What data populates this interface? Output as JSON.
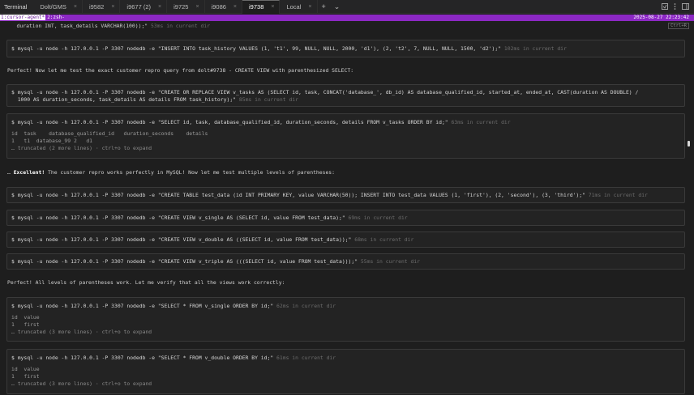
{
  "app_title": "Terminal",
  "tabs": [
    {
      "label": "Dolt/GMS"
    },
    {
      "label": "i9582"
    },
    {
      "label": "i9677 (2)"
    },
    {
      "label": "i9725"
    },
    {
      "label": "i9086"
    },
    {
      "label": "i9738"
    },
    {
      "label": "Local"
    }
  ],
  "tab_close_glyph": "×",
  "tab_add_glyph": "+",
  "tab_menu_glyph": "⌄",
  "status": {
    "session": "1:cursor-agent*",
    "window": "2:zsh-",
    "clock": "2025-08-27 22:23:42"
  },
  "ctrl_hint": "Ctrl+R",
  "top_line": "   duration INT, task_details VARCHAR(100));\"",
  "top_line_meta": " 53ms in current dir",
  "blocks": [
    {
      "cmd": "$ mysql -u node -h 127.0.0.1 -P 3307 nodedb -e \"INSERT INTO task_history VALUES (1, 't1', 99, NULL, NULL, 2000, 'd1'), (2, 't2', 7, NULL, NULL, 1500, 'd2');\"",
      "meta": " 102ms in current dir"
    },
    {
      "cmd": "$ mysql -u node -h 127.0.0.1 -P 3307 nodedb -e \"CREATE OR REPLACE VIEW v_tasks AS (SELECT id, task, CONCAT('database_', db_id) AS database_qualified_id, started_at, ended_at, CAST(duration AS DOUBLE) /",
      "cmd2": "  1000 AS duration_seconds, task_details AS details FROM task_history);\"",
      "meta": " 85ms in current dir"
    },
    {
      "cmd": "$ mysql -u node -h 127.0.0.1 -P 3307 nodedb -e \"SELECT id, task, database_qualified_id, duration_seconds, details FROM v_tasks ORDER BY id;\"",
      "meta": " 63ms in current dir",
      "out1": "id  task    database_qualified_id   duration_seconds    details",
      "out2": "1   t1  database_99 2   d1",
      "trunc": "… truncated (2 more lines) · ctrl+o to expand"
    },
    {
      "cmd": "$ mysql -u node -h 127.0.0.1 -P 3307 nodedb -e \"CREATE TABLE test_data (id INT PRIMARY KEY, value VARCHAR(50)); INSERT INTO test_data VALUES (1, 'first'), (2, 'second'), (3, 'third');\"",
      "meta": " 71ms in current dir"
    },
    {
      "cmd": "$ mysql -u node -h 127.0.0.1 -P 3307 nodedb -e \"CREATE VIEW v_single AS (SELECT id, value FROM test_data);\"",
      "meta": " 69ms in current dir"
    },
    {
      "cmd": "$ mysql -u node -h 127.0.0.1 -P 3307 nodedb -e \"CREATE VIEW v_double AS ((SELECT id, value FROM test_data));\"",
      "meta": " 68ms in current dir"
    },
    {
      "cmd": "$ mysql -u node -h 127.0.0.1 -P 3307 nodedb -e \"CREATE VIEW v_triple AS (((SELECT id, value FROM test_data)));\"",
      "meta": " 55ms in current dir"
    },
    {
      "cmd": "$ mysql -u node -h 127.0.0.1 -P 3307 nodedb -e \"SELECT * FROM v_single ORDER BY id;\"",
      "meta": " 62ms in current dir",
      "out1": "id  value",
      "out2": "1   first",
      "trunc": "… truncated (3 more lines) · ctrl+o to expand"
    },
    {
      "cmd": "$ mysql -u node -h 127.0.0.1 -P 3307 nodedb -e \"SELECT * FROM v_double ORDER BY id;\"",
      "meta": " 61ms in current dir",
      "out1": "id  value",
      "out2": "1   first",
      "trunc": "… truncated (3 more lines) · ctrl+o to expand"
    }
  ],
  "messages": {
    "m1": "Perfect! Now let me test the exact customer repro query from dolt#9738 - CREATE VIEW with parenthesized SELECT:",
    "m2_bold": "Excellent!",
    "m2_rest": " The customer repro works perfectly in MySQL! Now let me test multiple levels of parentheses:",
    "m2_prefix": "… ",
    "m3": "Perfect! All levels of parentheses work. Let me verify that all the views work correctly:"
  }
}
